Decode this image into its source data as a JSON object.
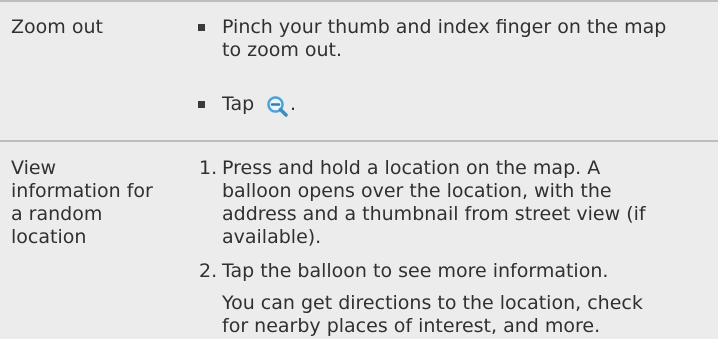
{
  "rows": [
    {
      "label": "Zoom out",
      "steps": [
        {
          "marker": "bullet",
          "lines": [
            "Pinch your thumb and index finger on the map",
            "to zoom out."
          ]
        },
        {
          "marker": "bullet",
          "text_before": "Tap",
          "icon": "zoom-out-icon",
          "text_after": "."
        }
      ]
    },
    {
      "label_lines": [
        "View",
        "information for",
        "a random",
        "location"
      ],
      "steps": [
        {
          "number": "1.",
          "lines": [
            "Press and hold a location on the map. A",
            "balloon opens over the location, with the",
            "address and a thumbnail from street view (if",
            "available)."
          ]
        },
        {
          "number": "2.",
          "lines": [
            "Tap the balloon to see more information."
          ]
        },
        {
          "lines": [
            "You can get directions to the location, check",
            "for nearby places of interest, and more."
          ]
        }
      ]
    }
  ],
  "colors": {
    "background": "#ececec",
    "divider": "#bdbdbd",
    "text": "#303030",
    "icon_accent": "#4aa3d8"
  }
}
